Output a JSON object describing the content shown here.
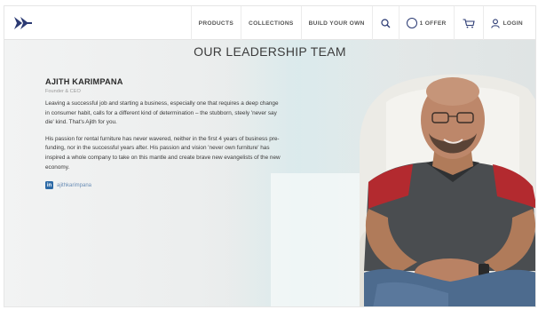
{
  "header": {
    "logo_icon": "arrow-logo-icon",
    "nav": [
      {
        "label": "PRODUCTS"
      },
      {
        "label": "COLLECTIONS"
      },
      {
        "label": "BUILD YOUR OWN"
      }
    ],
    "search_icon": "search-icon",
    "offer_label": "1 OFFER",
    "cart_icon": "cart-icon",
    "login_label": "LOGIN",
    "accent_color": "#2b3a73"
  },
  "main": {
    "title": "OUR LEADERSHIP TEAM",
    "bio": {
      "name": "AJITH KARIMPANA",
      "role": "Founder & CEO",
      "paragraphs": [
        "Leaving a successful job and starting a business, especially one that requires a deep change in consumer habit, calls for a different kind of determination – the stubborn, steely 'never say die' kind. That's Ajith for you.",
        "His passion for rental furniture has never wavered, neither in the first 4 years of business pre-funding, nor in the successful years after. His passion and vision 'never own furniture' has inspired a whole company to take on this mantle and create brave new evangelists of the new economy."
      ],
      "linkedin_icon": "linkedin-icon",
      "linkedin_handle": "ajithkarimpana"
    },
    "portrait_icon": "portrait-photo"
  }
}
